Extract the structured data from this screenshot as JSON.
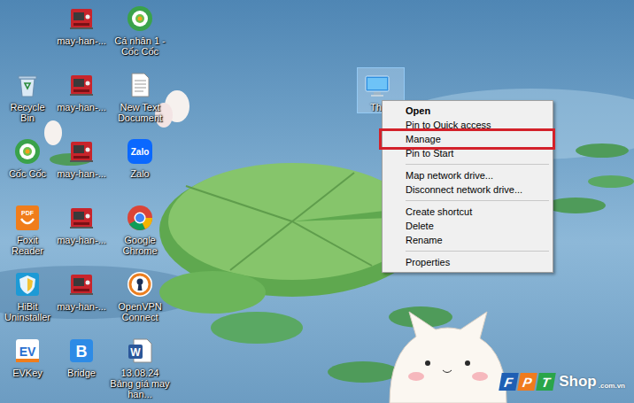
{
  "desktop": {
    "columns": [
      [
        {
          "label": "Recycle Bin",
          "kind": "recycle"
        },
        {
          "label": "Cốc Cốc",
          "kind": "coccoc"
        },
        {
          "label": "Foxit Reader",
          "kind": "foxit",
          "glyph": "PDF"
        },
        {
          "label": "HiBit Uninstaller",
          "kind": "hibit"
        },
        {
          "label": "EVKey",
          "kind": "evkey",
          "glyph": "EV"
        }
      ],
      [
        {
          "label": "may-han-...",
          "kind": "machine"
        },
        {
          "label": "may-han-...",
          "kind": "machine"
        },
        {
          "label": "may-han-...",
          "kind": "machine"
        },
        {
          "label": "may-han-...",
          "kind": "machine"
        },
        {
          "label": "may-han-...",
          "kind": "machine"
        },
        {
          "label": "Bridge",
          "kind": "bridge",
          "glyph": "B"
        }
      ],
      [
        {
          "label": "Cá nhân 1 - Cốc Cốc",
          "kind": "coccoc"
        },
        {
          "label": "New Text Document",
          "kind": "text"
        },
        {
          "label": "Zalo",
          "kind": "zalo",
          "glyph": "Zalo"
        },
        {
          "label": "Google Chrome",
          "kind": "chrome"
        },
        {
          "label": "OpenVPN Connect",
          "kind": "openvpn"
        },
        {
          "label": "13.08.24 Bảng giá may han...",
          "kind": "word",
          "glyph": "W"
        }
      ]
    ],
    "selected_icon": {
      "label": "Thi",
      "kind": "pc",
      "selected": true
    }
  },
  "context_menu": {
    "items": [
      {
        "kind": "item",
        "label": "Open",
        "default": true,
        "highlighted": false
      },
      {
        "kind": "item",
        "label": "Pin to Quick access",
        "default": false,
        "highlighted": false
      },
      {
        "kind": "item",
        "label": "Manage",
        "default": false,
        "highlighted": true
      },
      {
        "kind": "item",
        "label": "Pin to Start",
        "default": false,
        "highlighted": false
      },
      {
        "kind": "separator"
      },
      {
        "kind": "item",
        "label": "Map network drive...",
        "default": false,
        "highlighted": false
      },
      {
        "kind": "item",
        "label": "Disconnect network drive...",
        "default": false,
        "highlighted": false
      },
      {
        "kind": "separator"
      },
      {
        "kind": "item",
        "label": "Create shortcut",
        "default": false,
        "highlighted": false
      },
      {
        "kind": "item",
        "label": "Delete",
        "default": false,
        "highlighted": false
      },
      {
        "kind": "item",
        "label": "Rename",
        "default": false,
        "highlighted": false
      },
      {
        "kind": "separator"
      },
      {
        "kind": "item",
        "label": "Properties",
        "default": false,
        "highlighted": false
      }
    ]
  },
  "watermark": {
    "letters": [
      {
        "text": "F",
        "color": "#1e5fb4"
      },
      {
        "text": "P",
        "color": "#f07b1d"
      },
      {
        "text": "T",
        "color": "#2aa54a"
      }
    ],
    "name": "Shop",
    "suffix": ".com.vn"
  }
}
